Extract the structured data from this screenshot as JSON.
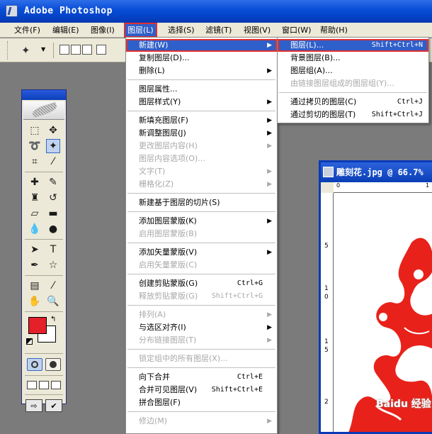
{
  "app": {
    "title": "Adobe Photoshop"
  },
  "menubar": [
    "文件(F)",
    "编辑(E)",
    "图像(I)",
    "图层(L)",
    "选择(S)",
    "滤镜(T)",
    "视图(V)",
    "窗口(W)",
    "帮助(H)"
  ],
  "document": {
    "title": "雕刻花.jpg @ 66.7%",
    "ruler_h": [
      "0",
      "1"
    ],
    "ruler_v": [
      "5",
      "1",
      "0",
      "1",
      "5",
      "2"
    ],
    "watermark": "Baidu 经验"
  },
  "layer_menu": [
    {
      "label": "新建(W)",
      "arrow": "▶",
      "highlight": true
    },
    {
      "label": "复制图层(D)..."
    },
    {
      "label": "删除(L)",
      "arrow": "▶"
    },
    {
      "sep": true
    },
    {
      "label": "图层属性..."
    },
    {
      "label": "图层样式(Y)",
      "arrow": "▶"
    },
    {
      "sep": true
    },
    {
      "label": "新填充图层(F)",
      "arrow": "▶"
    },
    {
      "label": "新调整图层(J)",
      "arrow": "▶"
    },
    {
      "label": "更改图层内容(H)",
      "arrow": "▶",
      "disabled": true
    },
    {
      "label": "图层内容选项(O)...",
      "disabled": true
    },
    {
      "label": "文字(T)",
      "arrow": "▶",
      "disabled": true
    },
    {
      "label": "栅格化(Z)",
      "arrow": "▶",
      "disabled": true
    },
    {
      "sep": true
    },
    {
      "label": "新建基于图层的切片(S)"
    },
    {
      "sep": true
    },
    {
      "label": "添加图层蒙版(K)",
      "arrow": "▶"
    },
    {
      "label": "启用图层蒙版(B)",
      "disabled": true
    },
    {
      "sep": true
    },
    {
      "label": "添加矢量蒙版(V)",
      "arrow": "▶"
    },
    {
      "label": "启用矢量蒙版(C)",
      "disabled": true
    },
    {
      "sep": true
    },
    {
      "label": "创建剪贴蒙版(G)",
      "shortcut": "Ctrl+G"
    },
    {
      "label": "释放剪贴蒙版(G)",
      "shortcut": "Shift+Ctrl+G",
      "disabled": true
    },
    {
      "sep": true
    },
    {
      "label": "排列(A)",
      "arrow": "▶",
      "disabled": true
    },
    {
      "label": "与选区对齐(I)",
      "arrow": "▶"
    },
    {
      "label": "分布链接图层(T)",
      "arrow": "▶",
      "disabled": true
    },
    {
      "sep": true
    },
    {
      "label": "锁定组中的所有图层(X)...",
      "disabled": true
    },
    {
      "sep": true
    },
    {
      "label": "向下合并",
      "shortcut": "Ctrl+E"
    },
    {
      "label": "合并可见图层(V)",
      "shortcut": "Shift+Ctrl+E"
    },
    {
      "label": "拼合图层(F)"
    },
    {
      "sep": true
    },
    {
      "label": "修边(M)",
      "arrow": "▶",
      "disabled": true
    }
  ],
  "new_submenu": [
    {
      "label": "图层(L)...",
      "shortcut": "Shift+Ctrl+N",
      "highlight": true
    },
    {
      "label": "背景图层(B)..."
    },
    {
      "label": "图层组(A)..."
    },
    {
      "label": "由链接图层组成的图层组(Y)...",
      "disabled": true
    },
    {
      "sep": true
    },
    {
      "label": "通过拷贝的图层(C)",
      "shortcut": "Ctrl+J"
    },
    {
      "label": "通过剪切的图层(T)",
      "shortcut": "Shift+Ctrl+J"
    }
  ],
  "colors": {
    "foreground": "#e5202a",
    "background": "#ffffff",
    "highlight": "#2f5fca",
    "title_bar": "#0a4fd8",
    "annotation": "#e03030"
  }
}
